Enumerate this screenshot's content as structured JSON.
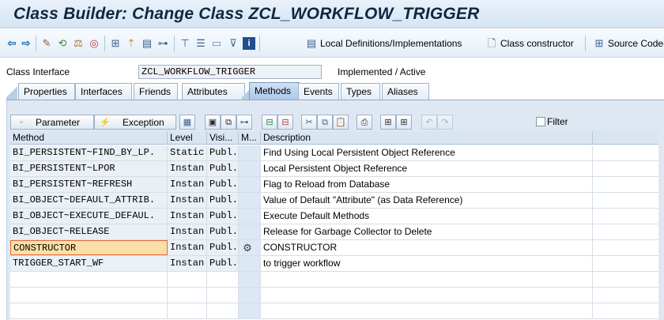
{
  "window": {
    "title": "Class Builder: Change Class ZCL_WORKFLOW_TRIGGER"
  },
  "toolbar": {
    "local_definitions_label": "Local Definitions/Implementations",
    "class_constructor_label": "Class constructor",
    "source_code_label": "Source Code-"
  },
  "class_interface": {
    "label": "Class Interface",
    "value": "ZCL_WORKFLOW_TRIGGER",
    "status": "Implemented / Active"
  },
  "tabs": [
    "Properties",
    "Interfaces",
    "Friends",
    "Attributes",
    "Methods",
    "Events",
    "Types",
    "Aliases"
  ],
  "active_tab": "Methods",
  "methods_toolbar": {
    "parameter_label": "Parameter",
    "exception_label": "Exception",
    "filter_label": "Filter",
    "filter_checked": false
  },
  "table": {
    "headers": [
      "Method",
      "Level",
      "Visi...",
      "M...",
      "Description"
    ],
    "rows": [
      {
        "method": "BI_PERSISTENT~FIND_BY_LP.",
        "level": "Static.",
        "visibility": "Publ.",
        "m": "",
        "description": "Find Using Local Persistent Object Reference"
      },
      {
        "method": "BI_PERSISTENT~LPOR",
        "level": "Instan.",
        "visibility": "Publ.",
        "m": "",
        "description": "Local Persistent Object Reference"
      },
      {
        "method": "BI_PERSISTENT~REFRESH",
        "level": "Instan.",
        "visibility": "Publ.",
        "m": "",
        "description": "Flag to Reload from Database"
      },
      {
        "method": "BI_OBJECT~DEFAULT_ATTRIB.",
        "level": "Instan.",
        "visibility": "Publ.",
        "m": "",
        "description": "Value of Default \"Attribute\" (as Data Reference)"
      },
      {
        "method": "BI_OBJECT~EXECUTE_DEFAUL.",
        "level": "Instan.",
        "visibility": "Publ.",
        "m": "",
        "description": "Execute Default Methods"
      },
      {
        "method": "BI_OBJECT~RELEASE",
        "level": "Instan.",
        "visibility": "Publ.",
        "m": "",
        "description": "Release for Garbage Collector to Delete"
      },
      {
        "method": "CONSTRUCTOR",
        "level": "Instan.",
        "visibility": "Publ.",
        "m": "constructor-icon",
        "description": "CONSTRUCTOR"
      },
      {
        "method": "TRIGGER_START_WF",
        "level": "Instan.",
        "visibility": "Publ.",
        "m": "",
        "description": "to trigger workflow"
      }
    ],
    "focused_row": 6
  },
  "colors": {
    "title": "#0f2740",
    "focus_fill": "#fbdfa6",
    "focus_border": "#e06a3a",
    "readonly_cell": "#eaf0f6"
  }
}
